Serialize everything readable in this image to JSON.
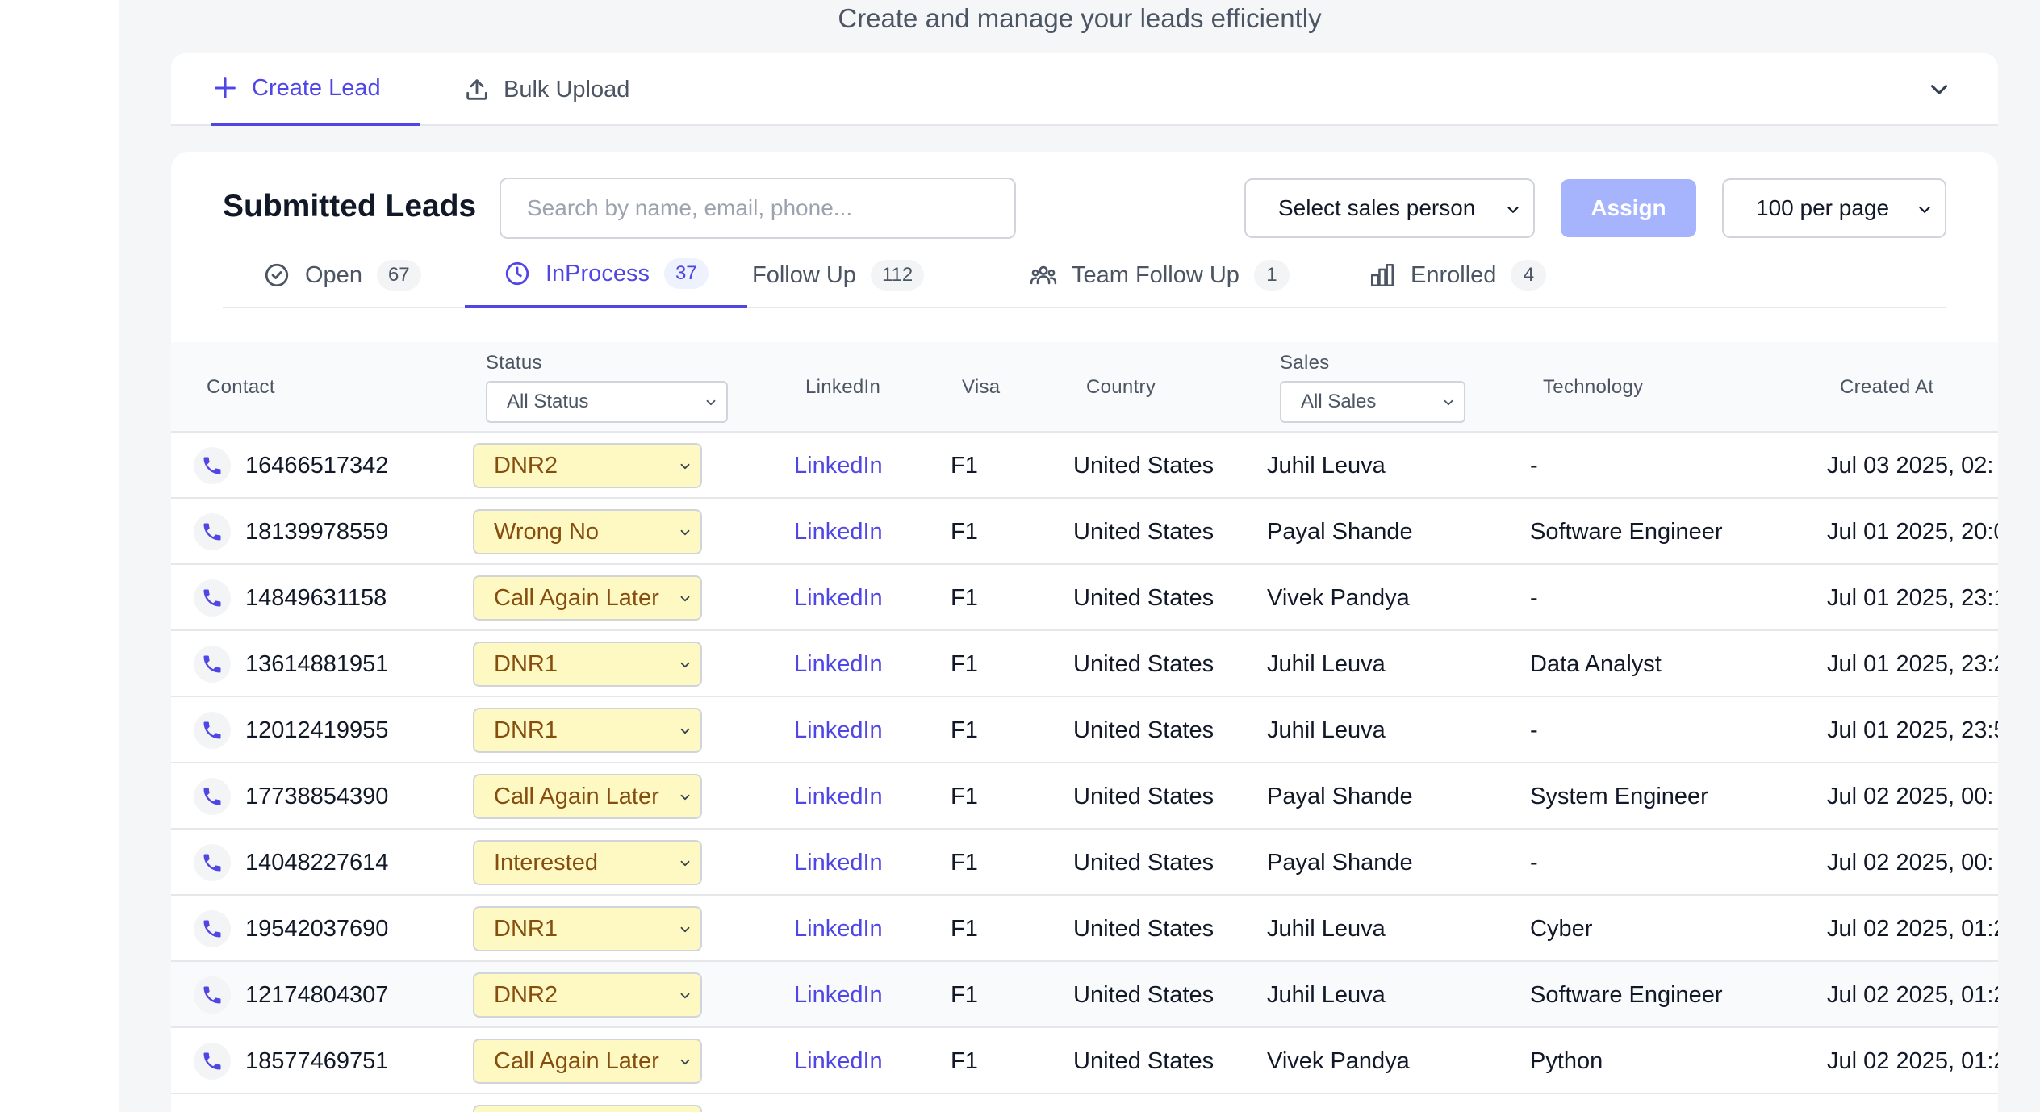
{
  "header": {
    "subtitle": "Create and manage your leads efficiently"
  },
  "top_tabs": [
    {
      "label": "Create Lead",
      "icon": "plus-icon",
      "active": true
    },
    {
      "label": "Bulk Upload",
      "icon": "upload-icon",
      "active": false
    }
  ],
  "card": {
    "title": "Submitted Leads",
    "search_placeholder": "Search by name, email, phone...",
    "sales_select": "Select sales person",
    "assign_label": "Assign",
    "per_page": "100 per page"
  },
  "status_tabs": [
    {
      "label": "Open",
      "count": "67",
      "icon": "check-circle-icon",
      "active": false
    },
    {
      "label": "InProcess",
      "count": "37",
      "icon": "clock-icon",
      "active": true
    },
    {
      "label": "Follow Up",
      "count": "112",
      "icon": "",
      "active": false
    },
    {
      "label": "Team Follow Up",
      "count": "1",
      "icon": "users-icon",
      "active": false
    },
    {
      "label": "Enrolled",
      "count": "4",
      "icon": "bar-chart-icon",
      "active": false
    }
  ],
  "table": {
    "headers": {
      "contact": "Contact",
      "status": "Status",
      "status_filter": "All Status",
      "linkedin": "LinkedIn",
      "visa": "Visa",
      "country": "Country",
      "sales": "Sales",
      "sales_filter": "All Sales",
      "technology": "Technology",
      "created_at": "Created At"
    },
    "rows": [
      {
        "phone": "16466517342",
        "status": "DNR2",
        "linkedin": "LinkedIn",
        "visa": "F1",
        "country": "United States",
        "sales": "Juhil Leuva",
        "technology": "-",
        "created": "Jul 03 2025, 02:"
      },
      {
        "phone": "18139978559",
        "status": "Wrong No",
        "linkedin": "LinkedIn",
        "visa": "F1",
        "country": "United States",
        "sales": "Payal Shande",
        "technology": "Software Engineer",
        "created": "Jul 01 2025, 20:0"
      },
      {
        "phone": "14849631158",
        "status": "Call Again Later",
        "linkedin": "LinkedIn",
        "visa": "F1",
        "country": "United States",
        "sales": "Vivek Pandya",
        "technology": "-",
        "created": "Jul 01 2025, 23:1"
      },
      {
        "phone": "13614881951",
        "status": "DNR1",
        "linkedin": "LinkedIn",
        "visa": "F1",
        "country": "United States",
        "sales": "Juhil Leuva",
        "technology": "Data Analyst",
        "created": "Jul 01 2025, 23:2"
      },
      {
        "phone": "12012419955",
        "status": "DNR1",
        "linkedin": "LinkedIn",
        "visa": "F1",
        "country": "United States",
        "sales": "Juhil Leuva",
        "technology": "-",
        "created": "Jul 01 2025, 23:5"
      },
      {
        "phone": "17738854390",
        "status": "Call Again Later",
        "linkedin": "LinkedIn",
        "visa": "F1",
        "country": "United States",
        "sales": "Payal Shande",
        "technology": "System Engineer",
        "created": "Jul 02 2025, 00:"
      },
      {
        "phone": "14048227614",
        "status": "Interested",
        "linkedin": "LinkedIn",
        "visa": "F1",
        "country": "United States",
        "sales": "Payal Shande",
        "technology": "-",
        "created": "Jul 02 2025, 00:"
      },
      {
        "phone": "19542037690",
        "status": "DNR1",
        "linkedin": "LinkedIn",
        "visa": "F1",
        "country": "United States",
        "sales": "Juhil Leuva",
        "technology": "Cyber",
        "created": "Jul 02 2025, 01:2"
      },
      {
        "phone": "12174804307",
        "status": "DNR2",
        "linkedin": "LinkedIn",
        "visa": "F1",
        "country": "United States",
        "sales": "Juhil Leuva",
        "technology": "Software Engineer",
        "created": "Jul 02 2025, 01:2"
      },
      {
        "phone": "18577469751",
        "status": "Call Again Later",
        "linkedin": "LinkedIn",
        "visa": "F1",
        "country": "United States",
        "sales": "Vivek Pandya",
        "technology": "Python",
        "created": "Jul 02 2025, 01:2"
      }
    ]
  },
  "colors": {
    "accent": "#4f46e5",
    "assign_disabled": "#a5b4fc",
    "status_bg": "#fef9c3",
    "status_text": "#854d0e"
  }
}
